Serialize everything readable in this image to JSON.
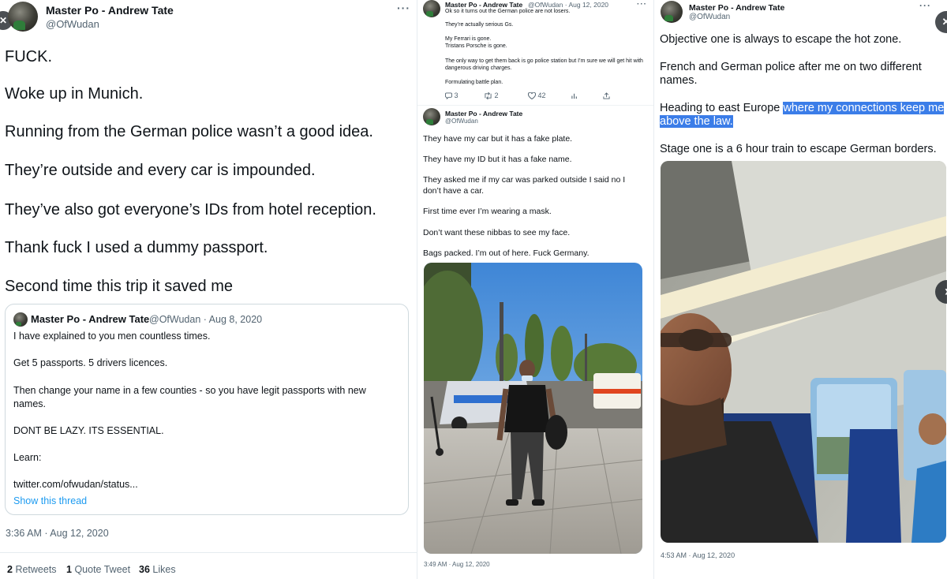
{
  "left": {
    "author_name": "Master Po - Andrew Tate",
    "author_handle": "@OfWudan",
    "more_label": "···",
    "nav_prev_label": "✕",
    "lines": [
      "FUCK.",
      "Woke up in Munich.",
      "Running from the German police wasn’t a good idea.",
      "They’re outside and every car is impounded.",
      "They’ve also got everyone’s IDs from hotel reception.",
      "Thank fuck I used a dummy passport.",
      "Second time this trip it saved me"
    ],
    "quote": {
      "name": "Master Po - Andrew Tate",
      "handle_date": "@OfWudan · Aug 8, 2020",
      "lines": [
        "I have explained to you men countless times.",
        "Get 5 passports. 5 drivers licences.",
        "Then change your name in a few counties - so you have legit passports with new",
        "names.",
        "DONT BE LAZY. ITS ESSENTIAL.",
        "Learn:",
        "twitter.com/ofwudan/status..."
      ],
      "show_thread": "Show this thread"
    },
    "timestamp": "3:36 AM · Aug 12, 2020",
    "stats": {
      "retweets_count": "2",
      "retweets_label": "Retweets",
      "quotes_count": "1",
      "quotes_label": "Quote Tweet",
      "likes_count": "36",
      "likes_label": "Likes"
    }
  },
  "middle": {
    "top_tweet": {
      "name": "Master Po - Andrew Tate",
      "handle_date": "@OfWudan · Aug 12, 2020",
      "lines": [
        "Ok so it turns out the German police are not losers.",
        "They’re actually serious Gs.",
        "My Ferrari is gone.",
        "Tristans Porsche is gone.",
        "The only way to get them back is go police station but I’m sure we will get hit with",
        "dangerous driving charges.",
        "Formulating battle plan."
      ],
      "actions": {
        "reply_count": "3",
        "retweet_count": "2",
        "like_count": "42"
      }
    },
    "second_tweet": {
      "name": "Master Po - Andrew Tate",
      "handle": "@OfWudan",
      "lines": [
        "They have my car but it has a fake plate.",
        "They have my ID but it has a fake name.",
        "They asked me if my car was parked outside I said no I",
        "don’t have a car.",
        "First time ever I’m wearing a mask.",
        "Don’t want these nibbas to see my face.",
        "Bags packed. I’m out of here. Fuck Germany."
      ],
      "timestamp": "3:49 AM · Aug 12, 2020"
    }
  },
  "right": {
    "name": "Master Po - Andrew Tate",
    "handle": "@OfWudan",
    "line1": "Objective one is always to escape the hot zone.",
    "line2a": "French and German police after me on two different",
    "line2b": "names.",
    "line3_plain": "Heading to east Europe ",
    "line3_highlight": "where my connections keep me",
    "line3b_highlight": "above the law.",
    "line4": "Stage one is a 6 hour train to escape German borders.",
    "timestamp": "4:53 AM · Aug 12, 2020",
    "nav_next_label": "›"
  },
  "colors": {
    "text": "#0f1419",
    "muted": "#536471",
    "link": "#1d9bf0",
    "highlight": "#3b7de8",
    "border": "#cfd9de"
  },
  "icons": [
    "reply-icon",
    "retweet-icon",
    "like-icon",
    "analytics-icon",
    "share-icon",
    "close-icon",
    "chevron-right-icon",
    "more-icon"
  ]
}
